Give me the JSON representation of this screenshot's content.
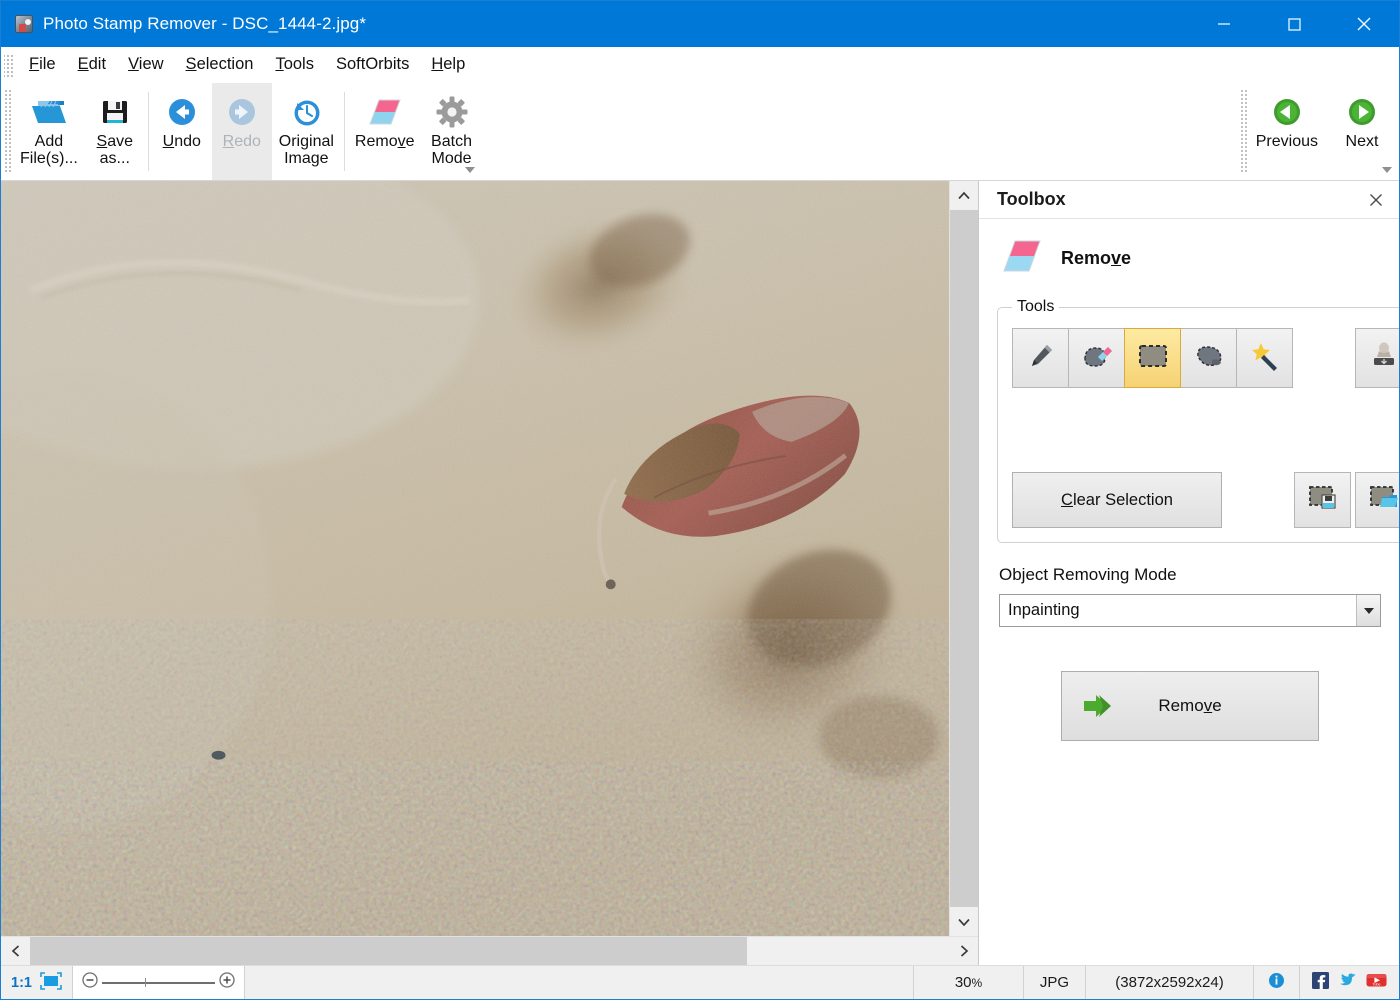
{
  "window": {
    "title": "Photo Stamp Remover - DSC_1444-2.jpg*",
    "app_icon": "photo-stamp-remover-icon",
    "accent_color": "#0078d7",
    "controls": {
      "minimize": "minimize-icon",
      "maximize": "maximize-icon",
      "close": "close-icon"
    }
  },
  "menubar": {
    "items": [
      {
        "label": "File",
        "accel": "F"
      },
      {
        "label": "Edit",
        "accel": "E"
      },
      {
        "label": "View",
        "accel": "V"
      },
      {
        "label": "Selection",
        "accel": "S"
      },
      {
        "label": "Tools",
        "accel": "T"
      },
      {
        "label": "SoftOrbits",
        "accel": ""
      },
      {
        "label": "Help",
        "accel": "H"
      }
    ]
  },
  "toolbar": {
    "buttons": [
      {
        "id": "add-files",
        "line1": "Add",
        "line2": "File(s)...",
        "icon": "open-folder-icon",
        "enabled": true,
        "pressed": false
      },
      {
        "id": "save-as",
        "line1": "Save",
        "line2": "as...",
        "icon": "floppy-disk-icon",
        "enabled": true,
        "pressed": false
      },
      {
        "id": "undo",
        "line1": "Undo",
        "line2": "",
        "icon": "undo-arrow-icon",
        "enabled": true,
        "pressed": false
      },
      {
        "id": "redo",
        "line1": "Redo",
        "line2": "",
        "icon": "redo-arrow-icon",
        "enabled": false,
        "pressed": true
      },
      {
        "id": "original-image",
        "line1": "Original",
        "line2": "Image",
        "icon": "clock-history-icon",
        "enabled": true,
        "pressed": false
      },
      {
        "id": "remove",
        "line1": "Remove",
        "line2": "",
        "icon": "eraser-icon",
        "enabled": true,
        "pressed": false
      },
      {
        "id": "batch-mode",
        "line1": "Batch",
        "line2": "Mode",
        "icon": "gear-icon",
        "enabled": true,
        "pressed": false
      }
    ],
    "nav": [
      {
        "id": "previous",
        "label": "Previous",
        "icon": "green-left-arrow-icon"
      },
      {
        "id": "next",
        "label": "Next",
        "icon": "green-right-arrow-icon"
      }
    ],
    "overflow_icon": "toolbar-overflow-chevron-icon"
  },
  "toolbox": {
    "panel_title": "Toolbox",
    "close_icon": "close-icon",
    "mode_icon": "eraser-icon",
    "mode_title": "Remove",
    "mode_title_accel": "v",
    "tools_group_label": "Tools",
    "tools": [
      {
        "id": "pencil",
        "icon": "pencil-icon",
        "selected": false
      },
      {
        "id": "eraser-select",
        "icon": "selection-eraser-icon",
        "selected": false
      },
      {
        "id": "rectangle",
        "icon": "marquee-rectangle-icon",
        "selected": true
      },
      {
        "id": "lasso",
        "icon": "lasso-blob-icon",
        "selected": false
      },
      {
        "id": "magic-wand",
        "icon": "magic-wand-icon",
        "selected": false
      },
      {
        "id": "stamp",
        "icon": "clone-stamp-icon",
        "selected": false
      }
    ],
    "clear_selection_label": "Clear Selection",
    "clear_selection_accel": "C",
    "selection_io": [
      {
        "id": "save-selection",
        "icon": "save-selection-icon"
      },
      {
        "id": "load-selection",
        "icon": "load-selection-icon"
      }
    ],
    "mode_section_label": "Object Removing Mode",
    "mode_value": "Inpainting",
    "mode_options": [
      "Inpainting"
    ],
    "dropdown_icon": "chevron-down-icon",
    "remove_button": {
      "label": "Remove",
      "accel": "v",
      "icon": "green-double-arrow-icon"
    }
  },
  "canvas": {
    "image_description": "beach sand with dried red leaf and footprints",
    "scroll": {
      "v_up_icon": "chevron-up-icon",
      "v_down_icon": "chevron-down-icon",
      "h_left_icon": "chevron-left-icon",
      "h_right_icon": "chevron-right-icon",
      "h_thumb_percent": 78
    }
  },
  "statusbar": {
    "ratio": "1:1",
    "fit_icon": "fit-to-window-icon",
    "zoom_out_icon": "zoom-out-icon",
    "zoom_in_icon": "zoom-in-icon",
    "zoom_handle_icon": "slider-handle-icon",
    "zoom_percent": "30",
    "zoom_percent_suffix": "%",
    "format": "JPG",
    "dimensions": "(3872x2592x24)",
    "info_icon": "info-icon",
    "social": [
      {
        "id": "facebook",
        "icon": "facebook-icon",
        "color": "#3b5998"
      },
      {
        "id": "twitter",
        "icon": "twitter-icon",
        "color": "#29a9e0"
      },
      {
        "id": "youtube",
        "icon": "youtube-icon",
        "color": "#e02f2f"
      }
    ]
  }
}
